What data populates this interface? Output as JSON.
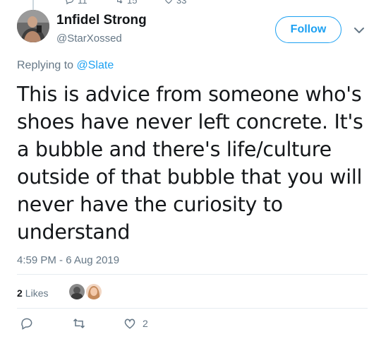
{
  "top_stats": {
    "replies": "11",
    "retweets": "15",
    "likes": "33"
  },
  "author": {
    "display_name": "1nfidel Strong",
    "handle": "@StarXossed"
  },
  "follow_label": "Follow",
  "reply": {
    "prefix": "Replying to",
    "mention": "@Slate"
  },
  "tweet_text": "This is advice from someone who's shoes have never left concrete. It's a bubble and there's life/culture outside of that bubble that you will never have the curiosity to understand",
  "timestamp": "4:59 PM - 6 Aug 2019",
  "likes": {
    "count": "2",
    "label": "Likes"
  },
  "actions": {
    "like_count": "2"
  },
  "colors": {
    "accent": "#1da1f2",
    "secondary_text": "#657786",
    "divider": "#e6ecf0"
  },
  "icons": [
    "reply-icon",
    "retweet-icon",
    "heart-icon",
    "chevron-down-icon"
  ]
}
